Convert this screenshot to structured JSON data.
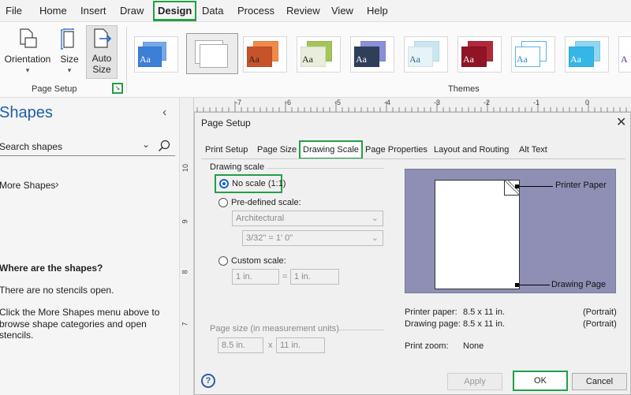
{
  "menu": {
    "items": [
      "File",
      "Home",
      "Insert",
      "Draw",
      "Design",
      "Data",
      "Process",
      "Review",
      "View",
      "Help"
    ],
    "active": "Design"
  },
  "ribbon": {
    "orientation_label": "Orientation",
    "size_label": "Size",
    "auto_size_label_1": "Auto",
    "auto_size_label_2": "Size",
    "page_setup_group": "Page Setup",
    "themes_group": "Themes",
    "theme_sample": "Aa",
    "theme_sample_partial": "A"
  },
  "shapes_pane": {
    "title": "Shapes",
    "collapse_icon": "chevron-left-icon",
    "search_placeholder": "Search shapes",
    "more_shapes": "More Shapes",
    "empty_heading": "Where are the shapes?",
    "empty_line1": "There are no stencils open.",
    "empty_line2a": "Click the More Shapes menu above to",
    "empty_line2b": "browse shape categories and open stencils."
  },
  "ruler": {
    "h_labels": [
      "-7",
      "-6",
      "-5",
      "-4",
      "-3",
      "-2",
      "-1",
      "0"
    ],
    "v_labels": [
      "10",
      "9",
      "8",
      "7"
    ]
  },
  "dialog": {
    "title": "Page Setup",
    "tabs": [
      "Print Setup",
      "Page Size",
      "Drawing Scale",
      "Page Properties",
      "Layout and Routing",
      "Alt Text"
    ],
    "selected_tab": "Drawing Scale",
    "section_label": "Drawing scale",
    "no_scale": "No scale (1:1)",
    "predefined": "Pre-defined scale:",
    "predefined_category": "Architectural",
    "predefined_value": "3/32\" = 1' 0\"",
    "custom": "Custom scale:",
    "custom_left": "1 in.",
    "custom_eq": "=",
    "custom_right": "1 in.",
    "page_size_label": "Page size (in measurement units)",
    "page_w": "8.5 in.",
    "page_x": "x",
    "page_h": "11 in.",
    "preview": {
      "printer_paper_label": "Printer Paper",
      "drawing_page_label": "Drawing Page"
    },
    "info": {
      "printer_paper_key": "Printer paper:",
      "printer_paper_val": "8.5 x 11 in.",
      "printer_paper_orient": "(Portrait)",
      "drawing_page_key": "Drawing page:",
      "drawing_page_val": "8.5 x 11 in.",
      "drawing_page_orient": "(Portrait)",
      "print_zoom_key": "Print zoom:",
      "print_zoom_val": "None"
    },
    "help_icon": "?",
    "apply": "Apply",
    "ok": "OK",
    "cancel": "Cancel"
  },
  "colors": {
    "highlight": "#22a045",
    "preview_bg": "#8f8fb5",
    "accent": "#1a64c8"
  }
}
